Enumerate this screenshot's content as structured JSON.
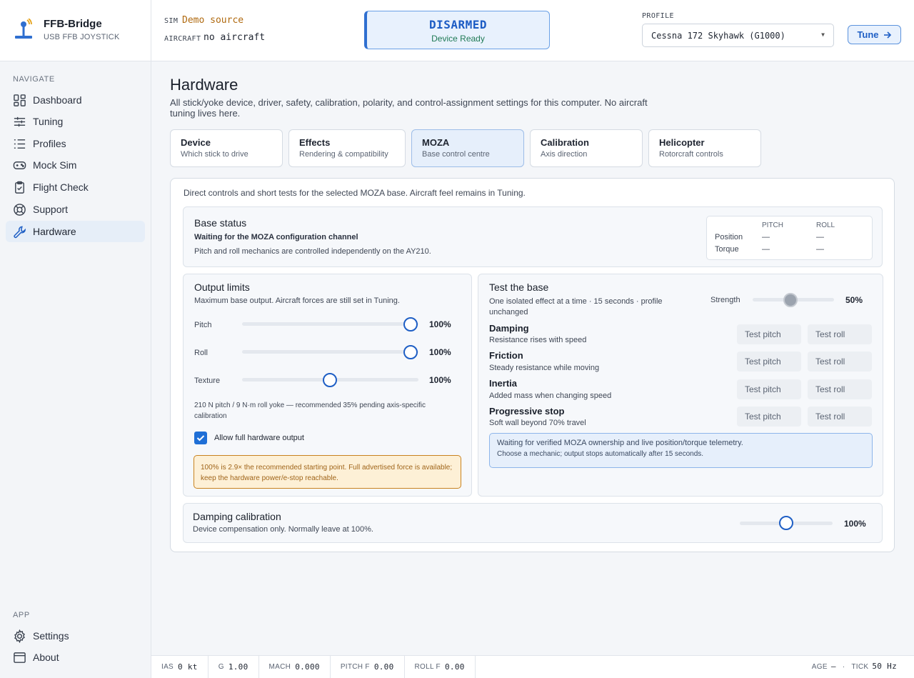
{
  "app": {
    "name": "FFB-Bridge",
    "subtitle": "USB FFB JOYSTICK"
  },
  "sidebar": {
    "navigate_heading": "NAVIGATE",
    "items": [
      {
        "label": "Dashboard",
        "icon": "grid-icon"
      },
      {
        "label": "Tuning",
        "icon": "sliders-icon"
      },
      {
        "label": "Profiles",
        "icon": "list-icon"
      },
      {
        "label": "Mock Sim",
        "icon": "gamepad-icon"
      },
      {
        "label": "Flight Check",
        "icon": "clipboard-check-icon"
      },
      {
        "label": "Support",
        "icon": "lifebuoy-icon"
      },
      {
        "label": "Hardware",
        "icon": "wrench-icon",
        "active": true
      }
    ],
    "app_heading": "APP",
    "app_items": [
      {
        "label": "Settings",
        "icon": "gear-icon"
      },
      {
        "label": "About",
        "icon": "window-icon"
      }
    ]
  },
  "topbar": {
    "sim_label": "SIM",
    "sim_value": "Demo source",
    "aircraft_label": "AIRCRAFT",
    "aircraft_value": "no aircraft",
    "status_main": "DISARMED",
    "status_sub": "Device Ready",
    "profile_label": "PROFILE",
    "profile_value": "Cessna 172 Skyhawk (G1000)",
    "tune_label": "Tune"
  },
  "page": {
    "title": "Hardware",
    "description": "All stick/yoke device, driver, safety, calibration, polarity, and control-assignment settings for this computer. No aircraft tuning lives here."
  },
  "tabs": [
    {
      "title": "Device",
      "subtitle": "Which stick to drive"
    },
    {
      "title": "Effects",
      "subtitle": "Rendering & compatibility"
    },
    {
      "title": "MOZA",
      "subtitle": "Base control centre",
      "active": true
    },
    {
      "title": "Calibration",
      "subtitle": "Axis direction"
    },
    {
      "title": "Helicopter",
      "subtitle": "Rotorcraft controls"
    }
  ],
  "moza": {
    "intro": "Direct controls and short tests for the selected MOZA base. Aircraft feel remains in Tuning.",
    "base_status": {
      "title": "Base status",
      "state": "Waiting for the MOZA configuration channel",
      "note": "Pitch and roll mechanics are controlled independently on the AY210.",
      "telemetry": {
        "col_pitch": "PITCH",
        "col_roll": "ROLL",
        "rows": [
          {
            "label": "Position",
            "pitch": "—",
            "roll": "—"
          },
          {
            "label": "Torque",
            "pitch": "—",
            "roll": "—"
          }
        ]
      }
    },
    "output_limits": {
      "title": "Output limits",
      "subtitle": "Maximum base output. Aircraft forces are still set in Tuning.",
      "sliders": [
        {
          "label": "Pitch",
          "value": 100,
          "display": "100%"
        },
        {
          "label": "Roll",
          "value": 100,
          "display": "100%"
        },
        {
          "label": "Texture",
          "value": 50,
          "display": "100%"
        }
      ],
      "note": "210 N pitch / 9 N·m roll yoke — recommended 35% pending axis-specific calibration",
      "allow_full_label": "Allow full hardware output",
      "allow_full_checked": true,
      "warning": "100% is 2.9× the recommended starting point. Full advertised force is available; keep the hardware power/e-stop reachable."
    },
    "test_base": {
      "title": "Test the base",
      "subtitle": "One isolated effect at a time · 15 seconds · profile unchanged",
      "strength_label": "Strength",
      "strength_value": 50,
      "strength_display": "50%",
      "test_pitch_label": "Test pitch",
      "test_roll_label": "Test roll",
      "mechanics": [
        {
          "name": "Damping",
          "desc": "Resistance rises with speed"
        },
        {
          "name": "Friction",
          "desc": "Steady resistance while moving"
        },
        {
          "name": "Inertia",
          "desc": "Added mass when changing speed"
        },
        {
          "name": "Progressive stop",
          "desc": "Soft wall beyond 70% travel"
        }
      ],
      "info_line1": "Waiting for verified MOZA ownership and live position/torque telemetry.",
      "info_line2": "Choose a mechanic; output stops automatically after 15 seconds."
    },
    "damping_calibration": {
      "title": "Damping calibration",
      "subtitle": "Device compensation only. Normally leave at 100%.",
      "value": 50,
      "display": "100%"
    }
  },
  "statusbar": {
    "cells": [
      {
        "label": "IAS",
        "value": "0 kt"
      },
      {
        "label": "G",
        "value": "1.00"
      },
      {
        "label": "MACH",
        "value": "0.000"
      },
      {
        "label": "PITCH F",
        "value": "0.00"
      },
      {
        "label": "ROLL F",
        "value": "0.00"
      }
    ],
    "age_label": "AGE",
    "age_value": "—",
    "tick_label": "TICK",
    "tick_value": "50 Hz"
  },
  "colors": {
    "accent": "#1f5fc5",
    "active_tab_bg": "#e6effb",
    "warning_bg": "#fdf0d6",
    "warning_border": "#c9831f"
  }
}
